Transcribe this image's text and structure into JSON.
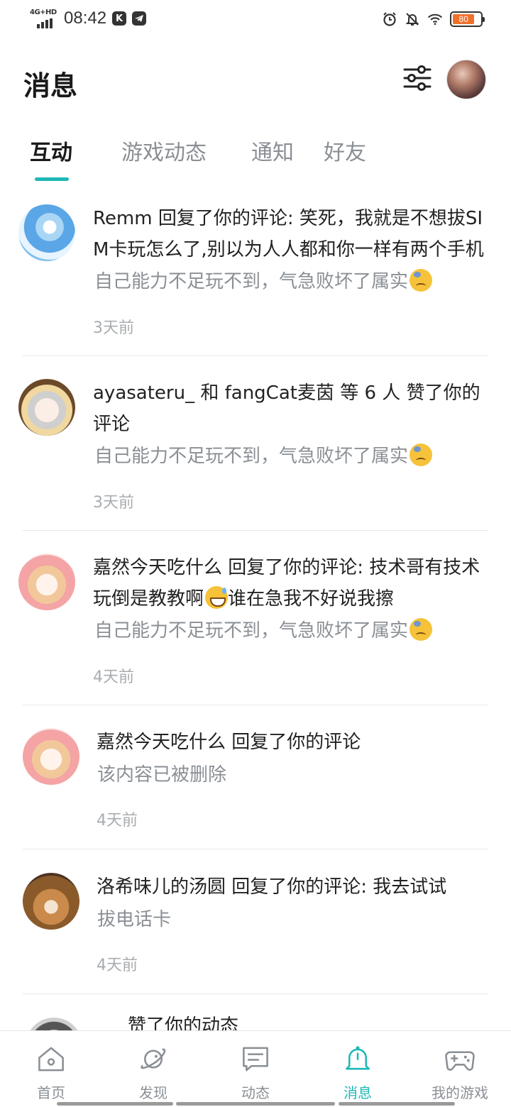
{
  "status_bar": {
    "network": "4G+HD",
    "time": "08:42",
    "app_icon_1": "K",
    "app_icon_2": "telegram-icon",
    "battery": "80",
    "battery_color": "#f0702a"
  },
  "header": {
    "title": "消息"
  },
  "tabs": [
    {
      "label": "互动",
      "active": true
    },
    {
      "label": "游戏动态",
      "active": false
    },
    {
      "label": "通知",
      "active": false
    },
    {
      "label": "好友",
      "active": false
    }
  ],
  "messages": [
    {
      "title": "Remm 回复了你的评论: 笑死，我就是不想拔SIM卡玩怎么了,别以为人人都和你一样有两个手机",
      "quote": "自己能力不足玩不到，气急败坏了属实",
      "quote_emoji": "sad-sweat-emoji",
      "time": "3天前"
    },
    {
      "title": "ayasateru_ 和 fangCat麦茵 等 6 人 赞了你的评论",
      "quote": "自己能力不足玩不到，气急败坏了属实",
      "quote_emoji": "sad-sweat-emoji",
      "time": "3天前"
    },
    {
      "title_before": "嘉然今天吃什么 回复了你的评论: 技术哥有技术玩倒是教教啊",
      "title_after": "谁在急我不好说我擦",
      "title_emoji": "grin-sweat-emoji",
      "quote": "自己能力不足玩不到，气急败坏了属实",
      "quote_emoji": "sad-sweat-emoji",
      "time": "4天前"
    },
    {
      "title": "嘉然今天吃什么 回复了你的评论",
      "quote": "该内容已被删除",
      "time": "4天前"
    },
    {
      "title": "洛希味儿的汤圆 回复了你的评论: 我去试试",
      "quote": "拔电话卡",
      "time": "4天前"
    },
    {
      "title": "赞了你的动态"
    }
  ],
  "bottom_nav": [
    {
      "label": "首页",
      "icon": "home-icon",
      "active": false
    },
    {
      "label": "发现",
      "icon": "planet-icon",
      "active": false
    },
    {
      "label": "动态",
      "icon": "chat-icon",
      "active": false
    },
    {
      "label": "消息",
      "icon": "bell-icon",
      "active": true
    },
    {
      "label": "我的游戏",
      "icon": "gamepad-icon",
      "active": false
    }
  ],
  "colors": {
    "accent": "#1fb8b6",
    "text_primary": "#222222",
    "text_secondary": "#8a8f95",
    "text_time": "#a8acb0"
  }
}
